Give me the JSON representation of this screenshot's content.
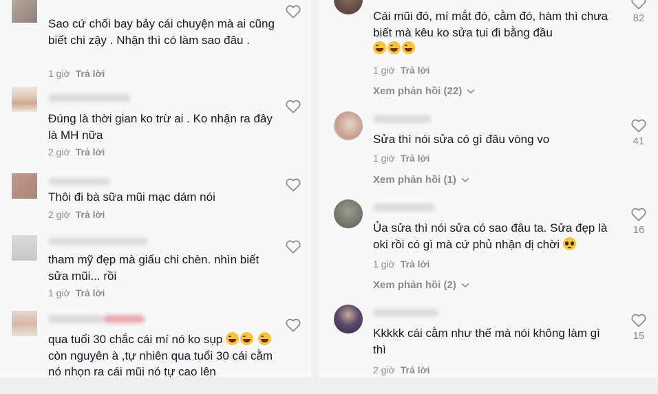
{
  "left_comments": [
    {
      "text": "Sao cứ chối bay bảy cái chuyện mà ai cũng biết chi zậy . Nhận thì có làm sao đâu .",
      "time": "1 giờ",
      "reply": "Trả lời"
    },
    {
      "text": "Đúng là thời gian ko trừ ai . Ko nhận ra đây là MH nữa",
      "time": "2 giờ",
      "reply": "Trả lời"
    },
    {
      "text": "Thôi đi bà sữa mũi mạc dám nói",
      "time": "2 giờ",
      "reply": "Trả lời"
    },
    {
      "text": "tham mỹ đẹp mà giấu chi chèn. nhìn biết sửa mũi... rồi",
      "time": "1 giờ",
      "reply": "Trả lời"
    },
    {
      "text_a": "qua tuổi 30 chắc cái mí nó ko sụp",
      "text_b": "còn nguyên à ,tự nhiên qua tuổi 30 cái cằm nó nhọn ra cái mũi nó tự cao lên"
    }
  ],
  "right_comments": [
    {
      "text": "Cái mũi đó, mí mắt đó, cằm đó, hàm thì chưa biết mà kêu ko sửa tui đi bằng đầu",
      "time": "1 giờ",
      "reply": "Trả lời",
      "view_replies": "Xem phản hồi (22)",
      "likes": "82"
    },
    {
      "text": "Sửa thì nói sửa có gì đâu vòng vo",
      "time": "1 giờ",
      "reply": "Trả lời",
      "view_replies": "Xem phản hồi (1)",
      "likes": "41"
    },
    {
      "text": "Ủa sửa thì nói sửa có sao đâu ta. Sửa đẹp là oki rồi có gì mà cứ phủ nhận dị chời",
      "time": "1 giờ",
      "reply": "Trả lời",
      "view_replies": "Xem phản hồi (2)",
      "likes": "16"
    },
    {
      "text": "Kkkkk cái cằm như thế mà nói không làm gì thì",
      "time": "2 giờ",
      "reply": "Trả lời",
      "likes": "15"
    }
  ],
  "icons": {
    "like": "heart-outline-icon",
    "expand": "chevron-down-icon",
    "emoji_laugh": "face-with-tears-of-joy",
    "emoji_plead": "pleading-face"
  },
  "colors": {
    "text": "#161823",
    "meta": "#8a8b91",
    "background": "#f8f8f8"
  }
}
